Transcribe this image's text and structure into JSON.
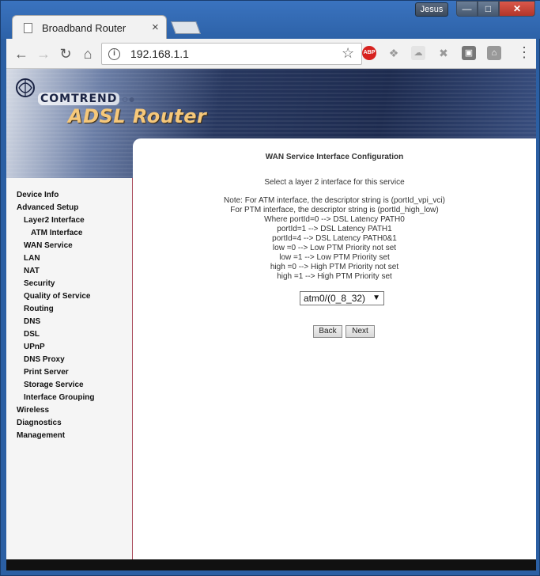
{
  "window": {
    "user": "Jesus",
    "minimize": "—",
    "maximize": "□",
    "close": "✕"
  },
  "browser": {
    "tab_title": "Broadband Router",
    "tab_close": "×",
    "url": "192.168.1.1",
    "extensions": {
      "abp": "ABP"
    }
  },
  "banner": {
    "brand": "COMTREND",
    "product": "ADSL Router"
  },
  "sidebar": {
    "items": [
      {
        "label": "Device Info",
        "level": 1
      },
      {
        "label": "Advanced Setup",
        "level": 1
      },
      {
        "label": "Layer2 Interface",
        "level": 2
      },
      {
        "label": "ATM Interface",
        "level": 3
      },
      {
        "label": "WAN Service",
        "level": 2
      },
      {
        "label": "LAN",
        "level": 2
      },
      {
        "label": "NAT",
        "level": 2
      },
      {
        "label": "Security",
        "level": 2
      },
      {
        "label": "Quality of Service",
        "level": 2
      },
      {
        "label": "Routing",
        "level": 2
      },
      {
        "label": "DNS",
        "level": 2
      },
      {
        "label": "DSL",
        "level": 2
      },
      {
        "label": "UPnP",
        "level": 2
      },
      {
        "label": "DNS Proxy",
        "level": 2
      },
      {
        "label": "Print Server",
        "level": 2
      },
      {
        "label": "Storage Service",
        "level": 2
      },
      {
        "label": "Interface Grouping",
        "level": 2
      },
      {
        "label": "Wireless",
        "level": 1
      },
      {
        "label": "Diagnostics",
        "level": 1
      },
      {
        "label": "Management",
        "level": 1
      }
    ]
  },
  "main": {
    "title": "WAN Service Interface Configuration",
    "subtitle": "Select a layer 2 interface for this service",
    "notes": [
      "Note: For ATM interface, the descriptor string is (portId_vpi_vci)",
      "For PTM interface, the descriptor string is (portId_high_low)",
      "Where portId=0 --> DSL Latency PATH0",
      "portId=1 --> DSL Latency PATH1",
      "portId=4 --> DSL Latency PATH0&1",
      "low =0 --> Low PTM Priority not set",
      "low =1 --> Low PTM Priority set",
      "high =0 --> High PTM Priority not set",
      "high =1 --> High PTM Priority set"
    ],
    "interface_select": {
      "selected": "atm0/(0_8_32)"
    },
    "back_label": "Back",
    "next_label": "Next"
  }
}
